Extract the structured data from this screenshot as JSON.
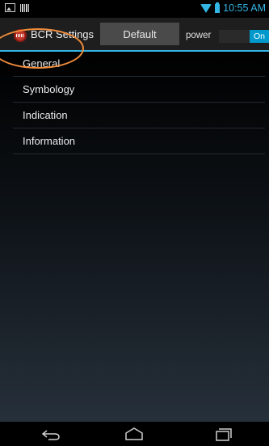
{
  "status_bar": {
    "time": "10:55 AM",
    "icons": [
      "image-icon",
      "barcode-icon",
      "wifi-icon",
      "battery-icon"
    ],
    "accent": "#33b5e5"
  },
  "action_bar": {
    "title": "BCR Settings",
    "default_button": "Default",
    "power_label": "power",
    "toggle_state": "On",
    "accent": "#33b5e5"
  },
  "menu": {
    "items": [
      {
        "label": "General"
      },
      {
        "label": "Symbology"
      },
      {
        "label": "Indication"
      },
      {
        "label": "Information"
      }
    ],
    "highlight_color": "#ef8c3a"
  },
  "nav_bar": {
    "buttons": [
      "back-icon",
      "home-icon",
      "recents-icon"
    ]
  }
}
